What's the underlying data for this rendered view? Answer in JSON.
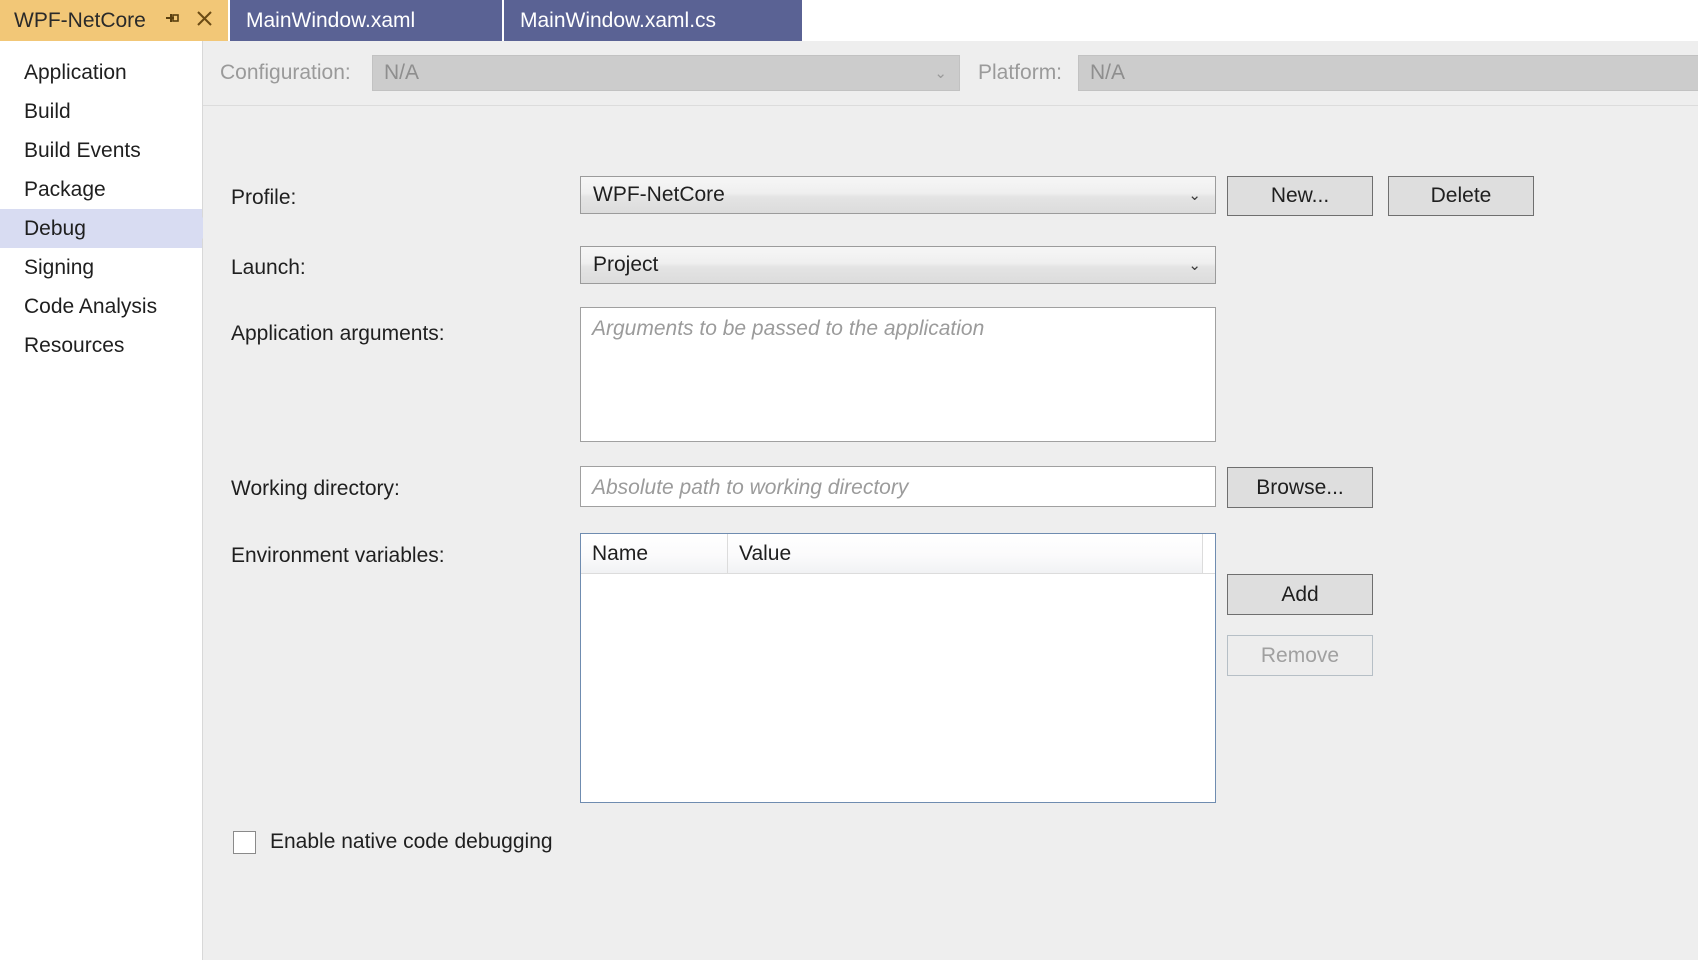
{
  "tabs": [
    {
      "label": "WPF-NetCore",
      "active": true,
      "pin_icon": "pin-icon",
      "close_icon": "close-icon"
    },
    {
      "label": "MainWindow.xaml",
      "active": false
    },
    {
      "label": "MainWindow.xaml.cs",
      "active": false
    }
  ],
  "sidebar": {
    "items": [
      {
        "label": "Application",
        "selected": false
      },
      {
        "label": "Build",
        "selected": false
      },
      {
        "label": "Build Events",
        "selected": false
      },
      {
        "label": "Package",
        "selected": false
      },
      {
        "label": "Debug",
        "selected": true
      },
      {
        "label": "Signing",
        "selected": false
      },
      {
        "label": "Code Analysis",
        "selected": false
      },
      {
        "label": "Resources",
        "selected": false
      }
    ]
  },
  "configbar": {
    "configuration_label": "Configuration:",
    "configuration_value": "N/A",
    "platform_label": "Platform:",
    "platform_value": "N/A",
    "chevron": "⌄"
  },
  "form": {
    "profile_label": "Profile:",
    "profile_value": "WPF-NetCore",
    "profile_new_button": "New...",
    "profile_delete_button": "Delete",
    "launch_label": "Launch:",
    "launch_value": "Project",
    "app_args_label": "Application arguments:",
    "app_args_placeholder": "Arguments to be passed to the application",
    "app_args_value": "",
    "working_dir_label": "Working directory:",
    "working_dir_placeholder": "Absolute path to working directory",
    "working_dir_value": "",
    "browse_button": "Browse...",
    "env_vars_label": "Environment variables:",
    "env_grid": {
      "columns": [
        "Name",
        "Value"
      ],
      "rows": []
    },
    "add_button": "Add",
    "remove_button": "Remove",
    "native_debug_label": "Enable native code debugging",
    "native_debug_checked": false,
    "chevron": "⌄"
  },
  "colors": {
    "active_tab_bg": "#f2c777",
    "inactive_tab_bg": "#5a6294",
    "sidebar_selected_bg": "#d8dcf2",
    "pane_bg": "#eeeeee",
    "grid_border": "#6f8cb0"
  }
}
